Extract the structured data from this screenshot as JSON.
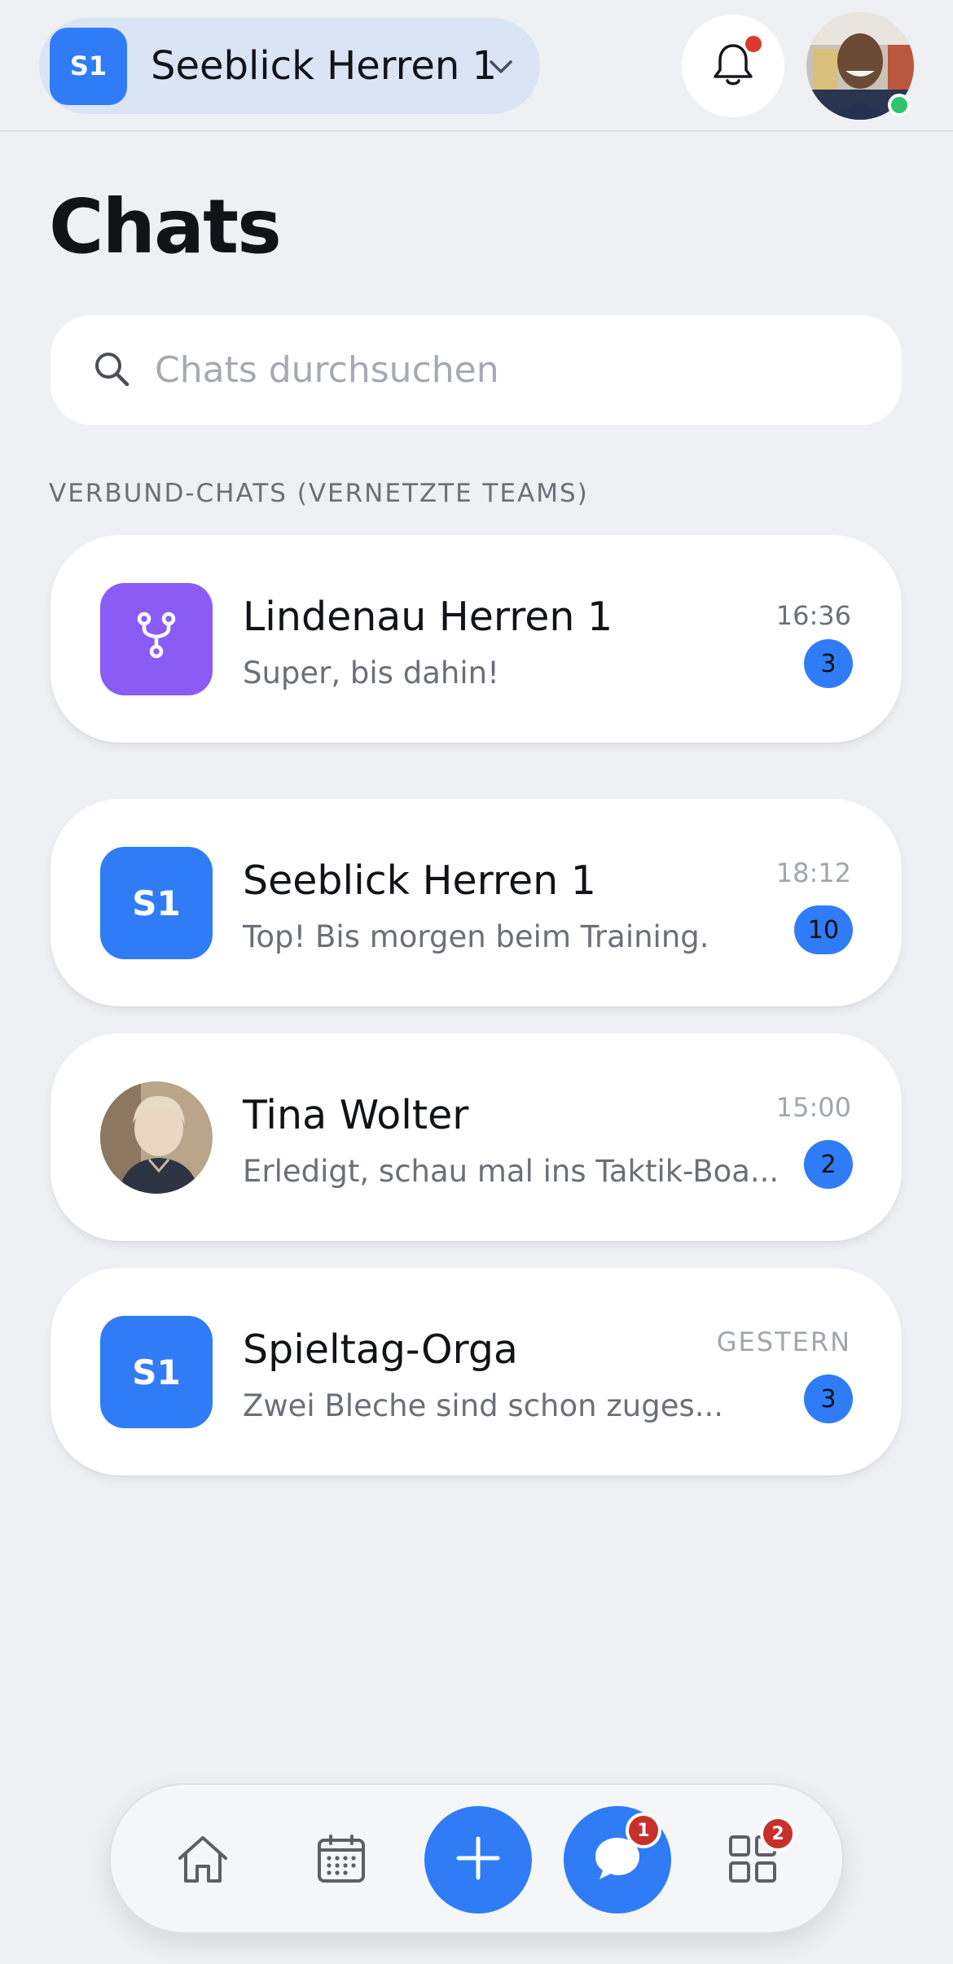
{
  "header": {
    "team_badge": "S1",
    "team_name": "Seeblick Herren 1",
    "icons": [
      "chevron-down-icon",
      "bell-icon"
    ],
    "has_notification_dot": true,
    "user_status": "online"
  },
  "title": "Chats",
  "search": {
    "placeholder": "Chats durchsuchen",
    "value": ""
  },
  "section_label": "VERBUND-CHATS (VERNETZTE TEAMS)",
  "chats": [
    {
      "name": "Lindenau Herren 1",
      "preview": "Super, bis dahin!",
      "time": "16:36",
      "unread": "3",
      "avatar_type": "fork-icon",
      "avatar_color": "#8a5cf5"
    },
    {
      "name": "Seeblick Herren 1",
      "preview": "Top! Bis morgen beim Training.",
      "time": "18:12",
      "unread": "10",
      "avatar_text": "S1",
      "avatar_color": "#2f7cf6"
    },
    {
      "name": "Tina Wolter",
      "preview": "Erledigt, schau mal ins Taktik-Boa...",
      "time": "15:00",
      "unread": "2",
      "avatar_type": "photo"
    },
    {
      "name": "Spieltag-Orga",
      "preview": "Zwei Bleche sind schon zuges...",
      "time": "GESTERN",
      "unread": "3",
      "avatar_text": "S1",
      "avatar_color": "#2f7cf6"
    }
  ],
  "nav": {
    "items": [
      "home-icon",
      "calendar-icon",
      "plus-icon",
      "chat-bubble-icon",
      "apps-grid-icon"
    ],
    "chat_badge": "1",
    "apps_badge": "2"
  },
  "colors": {
    "accent": "#2f7cf6",
    "background": "#eef0f4",
    "alert": "#c8302b",
    "online": "#2fc56a"
  }
}
